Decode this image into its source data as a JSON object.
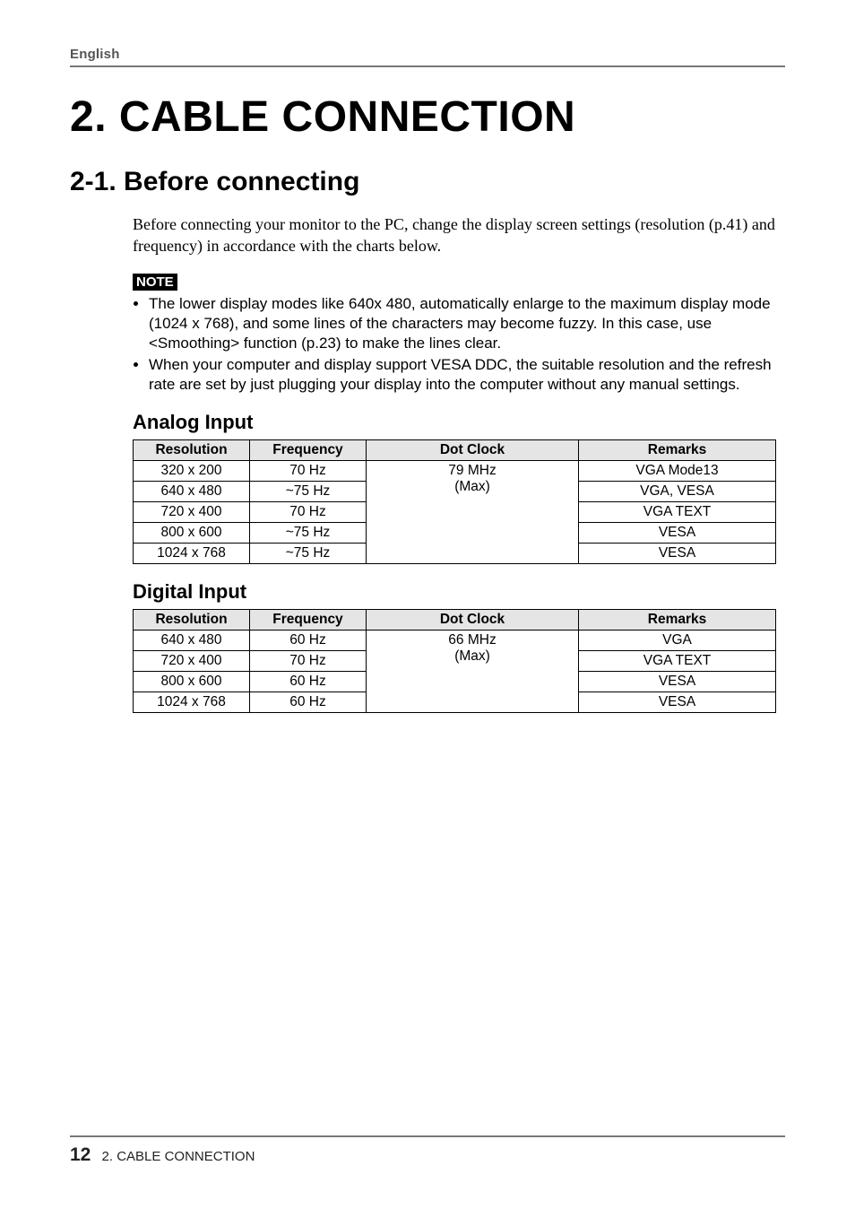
{
  "lang": "English",
  "title": "2. CABLE CONNECTION",
  "section_title": "2-1. Before connecting",
  "intro": "Before connecting your monitor to the PC, change the display screen settings (resolution (p.41) and frequency) in accordance with the charts below.",
  "note_label": "NOTE",
  "notes": [
    "The lower display modes like 640x 480, automatically enlarge to the maximum display mode (1024 x 768), and some lines of the characters may become fuzzy. In this case, use <Smoothing> function (p.23) to make the lines clear.",
    "When your computer and display support VESA DDC, the suitable resolution and the refresh rate are set by just plugging your display into the computer without any manual settings."
  ],
  "analog_heading": "Analog Input",
  "digital_heading": "Digital Input",
  "headers": {
    "resolution": "Resolution",
    "frequency": "Frequency",
    "dot_clock": "Dot Clock",
    "remarks": "Remarks"
  },
  "chart_data": [
    {
      "type": "table",
      "title": "Analog Input",
      "columns": [
        "Resolution",
        "Frequency",
        "Dot Clock",
        "Remarks"
      ],
      "dot_clock_merged": [
        "79 MHz",
        "(Max)"
      ],
      "rows": [
        {
          "resolution": "320 x 200",
          "frequency": "70 Hz",
          "remarks": "VGA Mode13"
        },
        {
          "resolution": "640 x 480",
          "frequency": "~75 Hz",
          "remarks": "VGA, VESA"
        },
        {
          "resolution": "720 x 400",
          "frequency": "70 Hz",
          "remarks": "VGA TEXT"
        },
        {
          "resolution": "800 x 600",
          "frequency": "~75 Hz",
          "remarks": "VESA"
        },
        {
          "resolution": "1024 x 768",
          "frequency": "~75 Hz",
          "remarks": "VESA"
        }
      ]
    },
    {
      "type": "table",
      "title": "Digital Input",
      "columns": [
        "Resolution",
        "Frequency",
        "Dot Clock",
        "Remarks"
      ],
      "dot_clock_merged": [
        "66 MHz",
        "(Max)"
      ],
      "rows": [
        {
          "resolution": "640 x 480",
          "frequency": "60 Hz",
          "remarks": "VGA"
        },
        {
          "resolution": "720 x 400",
          "frequency": "70 Hz",
          "remarks": "VGA TEXT"
        },
        {
          "resolution": "800 x 600",
          "frequency": "60 Hz",
          "remarks": "VESA"
        },
        {
          "resolution": "1024 x 768",
          "frequency": "60 Hz",
          "remarks": "VESA"
        }
      ]
    }
  ],
  "footer": {
    "page_number": "12",
    "section": "2. CABLE CONNECTION"
  }
}
